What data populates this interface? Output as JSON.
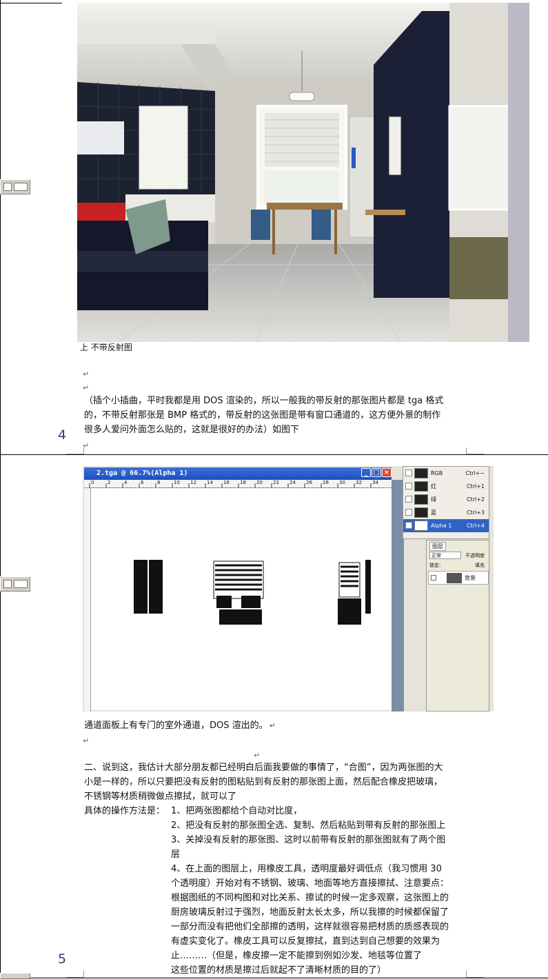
{
  "page": {
    "page_numbers": [
      "4",
      "5"
    ]
  },
  "photo": {
    "caption": "上 不带反射图"
  },
  "note": {
    "line1": "（插个小插曲，平时我都是用 DOS 渲染的，所以一般我的带反射的那张图片都是 tga 格式",
    "line2": "的，不带反射那张是 BMP 格式的，带反射的这张图是带有窗口通道的，这方便外景的制作",
    "line3": "很多人爱问外面怎么贴的，这就是很好的办法）如图下"
  },
  "photoshop": {
    "title": "2.tga @ 66.7%(Alpha 1)",
    "ruler_marks": [
      "0",
      "2",
      "4",
      "6",
      "8",
      "10",
      "12",
      "14",
      "16",
      "18",
      "20",
      "22",
      "24",
      "26",
      "28",
      "30",
      "32",
      "34"
    ],
    "channels": [
      {
        "name": "RGB",
        "shortcut": "Ctrl+~"
      },
      {
        "name": "红",
        "shortcut": "Ctrl+1"
      },
      {
        "name": "绿",
        "shortcut": "Ctrl+2"
      },
      {
        "name": "蓝",
        "shortcut": "Ctrl+3"
      },
      {
        "name": "Alpha 1",
        "shortcut": "Ctrl+4"
      }
    ],
    "layers": {
      "tab": "图层",
      "blend_mode": "正常",
      "opacity_label": "不透明度",
      "lock_label": "锁定:",
      "fill_label": "填充",
      "layer_name": "背景"
    }
  },
  "caption2": "通道面板上有专门的室外通道，DOS 渲出的。",
  "section2": {
    "p1_l1": "二、说到这，我估计大部分朋友都已经明白后面我要做的事情了，“合图”，因为两张图的大",
    "p1_l2": "小是一样的，所以只要把没有反射的图粘贴到有反射的那张图上面，然后配合橡皮把玻璃，",
    "p1_l3": "不锈钢等材质稍微做点擦拭，就可以了",
    "method_label": "具体的操作方法是：",
    "step1": "1、把两张图都给个自动对比度，",
    "step2": "2、把没有反射的那张图全选、复制、然后粘贴到带有反射的那张图上",
    "step3_l1": "3、关掉没有反射的那张图、这时以前带有反射的那张图就有了两个图",
    "step3_l2": "层",
    "step4_l1": "4、在上面的图层上，用橡皮工具，透明度最好调低点（我习惯用 30",
    "step4_l2": "个透明度）开始对有不锈钢、玻璃、地面等地方直接擦拭、注意要点：",
    "step4_l3": "根据图纸的不同构图和对比关系、擦试的时候一定多观察，这张图上的",
    "step4_l4": "厨房玻璃反射过于强烈，地面反射太长太多，所以我擦的时候都保留了",
    "step4_l5": "一部分而没有把他们全部擦的透明，这样就很容易把材质的质感表现的",
    "step4_l6": "有虚实变化了。橡皮工具可以反复擦拭，直到达到自己想要的效果为",
    "step4_l7": "止………（但是，橡皮擦一定不能擦到例如沙发、地毯等位置了",
    "step4_l8": "这些位置的材质是擦过后就起不了清晰材质的目的了）"
  }
}
